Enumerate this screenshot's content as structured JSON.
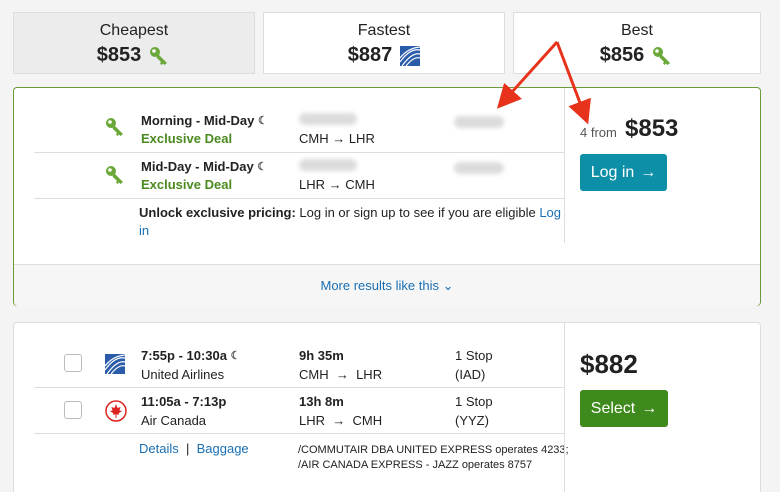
{
  "tabs": [
    {
      "label": "Cheapest",
      "price": "$853",
      "icon": "key-icon"
    },
    {
      "label": "Fastest",
      "price": "$887",
      "icon": "united-airlines-logo"
    },
    {
      "label": "Best",
      "price": "$856",
      "icon": "key-icon"
    }
  ],
  "deal": {
    "legs": [
      {
        "times": "Morning - Mid-Day",
        "moon": "☾",
        "badge": "Exclusive Deal",
        "route": "CMH → LHR"
      },
      {
        "times": "Mid-Day - Mid-Day",
        "moon": "☾",
        "badge": "Exclusive Deal",
        "route": "LHR → CMH"
      }
    ],
    "unlock_bold": "Unlock exclusive pricing:",
    "unlock_text": " Log in or sign up to see if you are eligible ",
    "unlock_link_1": "Log",
    "unlock_link_2": "in",
    "from_count": "4 from",
    "price": "$853",
    "login_label": "Log in",
    "more_results": "More results like this"
  },
  "result": {
    "legs": [
      {
        "times": "7:55p - 10:30a",
        "moon": "☾",
        "airline": "United Airlines",
        "duration": "9h 35m",
        "from": "CMH",
        "to": "LHR",
        "stops": "1 Stop",
        "via": "(IAD)"
      },
      {
        "times": "11:05a - 7:13p",
        "moon": "",
        "airline": "Air Canada",
        "duration": "13h 8m",
        "from": "LHR",
        "to": "CMH",
        "stops": "1 Stop",
        "via": "(YYZ)"
      }
    ],
    "arrow": "→",
    "details_label": "Details",
    "separator": "|",
    "baggage_label": "Baggage",
    "operated_line_1": "/COMMUTAIR DBA UNITED EXPRESS operates 4233;",
    "operated_line_2": "/AIR CANADA EXPRESS - JAZZ operates 8757",
    "price": "$882",
    "select_label": "Select"
  },
  "colors": {
    "green": "#4b8a1f",
    "teal": "#0e8fa8",
    "select_green": "#3f8a1d",
    "link": "#1a6fb4",
    "annotation_red": "#e8331c"
  }
}
